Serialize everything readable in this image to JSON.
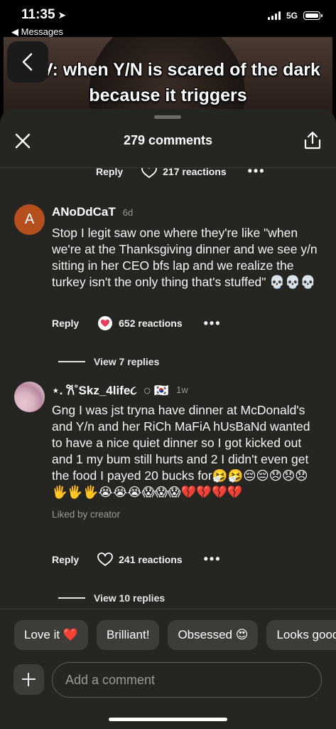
{
  "status_bar": {
    "time": "11:35",
    "back_label": "◀ Messages",
    "network": "5G"
  },
  "video": {
    "caption": "POV: when Y/N is scared of the dark because it triggers"
  },
  "sheet": {
    "title": "279 comments"
  },
  "partial_row": {
    "reply": "Reply",
    "reactions": "217 reactions",
    "more": "•••"
  },
  "comments": [
    {
      "avatar_letter": "A",
      "username": "ANoDdCaT",
      "timestamp": "6d",
      "text": "Stop I legit saw one where they're like \"when we're at the Thanksgiving dinner and we see y/n sitting in her CEO bfs lap and we realize the turkey isn't the only thing that's stuffed\" 💀💀💀",
      "reply": "Reply",
      "reactions": "652 reactions",
      "more": "•••",
      "view_replies": "View 7 replies"
    },
    {
      "username": "⋆. 𐙚˚Skz_4life૮ ⁠ ⁠◌ 🇰🇷",
      "timestamp": "1w",
      "text": "Gng I was jst tryna have dinner at McDonald's and Y/n and her RiCh MaFiA hUsBaNd wanted to have a nice quiet dinner so I got kicked out and 1 my bum still hurts and 2 I didn't even get the food I payed 20 bucks for🤧🤧😔😔😞😞😞🖐️🖐️🖐️😭😭😭😱😱😱💔💔💔💔",
      "liked_by": "Liked by creator",
      "reply": "Reply",
      "reactions": "241 reactions",
      "more": "•••",
      "view_replies": "View 10 replies"
    }
  ],
  "quick_chips": [
    "Love it ❤️",
    "Brilliant!",
    "Obsessed 😍",
    "Looks good"
  ],
  "input": {
    "placeholder": "Add a comment"
  },
  "colors": {
    "sheet_bg": "#252522",
    "chip_bg": "#3c3c38",
    "heart_badge": "#e83d5c",
    "avatar_a": "#b5501e"
  }
}
